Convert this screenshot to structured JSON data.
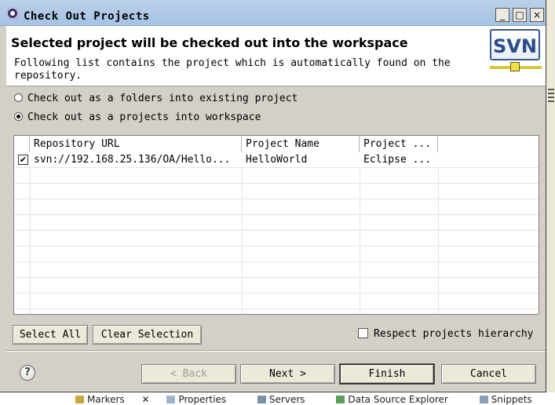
{
  "window": {
    "title": "Check Out Projects",
    "controls": {
      "minimize": "_",
      "maximize": "□",
      "close": "×"
    }
  },
  "banner": {
    "title": "Selected project will be checked out into the workspace",
    "description": "Following list contains the project which is automatically found on the repository.",
    "logo_text": "SVN"
  },
  "options": [
    {
      "label": "Check out as a folders into existing project",
      "selected": false
    },
    {
      "label": "Check out as a projects into workspace",
      "selected": true
    }
  ],
  "table": {
    "columns": [
      "Repository URL",
      "Project Name",
      "Project ..."
    ],
    "rows": [
      {
        "checked": true,
        "check_glyph": "✔",
        "url": "svn://192.168.25.136/OA/Hello...",
        "name": "HelloWorld",
        "type": "Eclipse ..."
      }
    ]
  },
  "buttons": {
    "select_all": "Select All",
    "clear_selection": "Clear Selection",
    "back": "< Back",
    "next": "Next >",
    "finish": "Finish",
    "cancel": "Cancel",
    "help": "?"
  },
  "respect_hierarchy": {
    "label": "Respect projects hierarchy",
    "checked": false
  },
  "background_tabs": [
    "Markers",
    "Properties",
    "Servers",
    "Data Source Explorer",
    "Snippets"
  ]
}
